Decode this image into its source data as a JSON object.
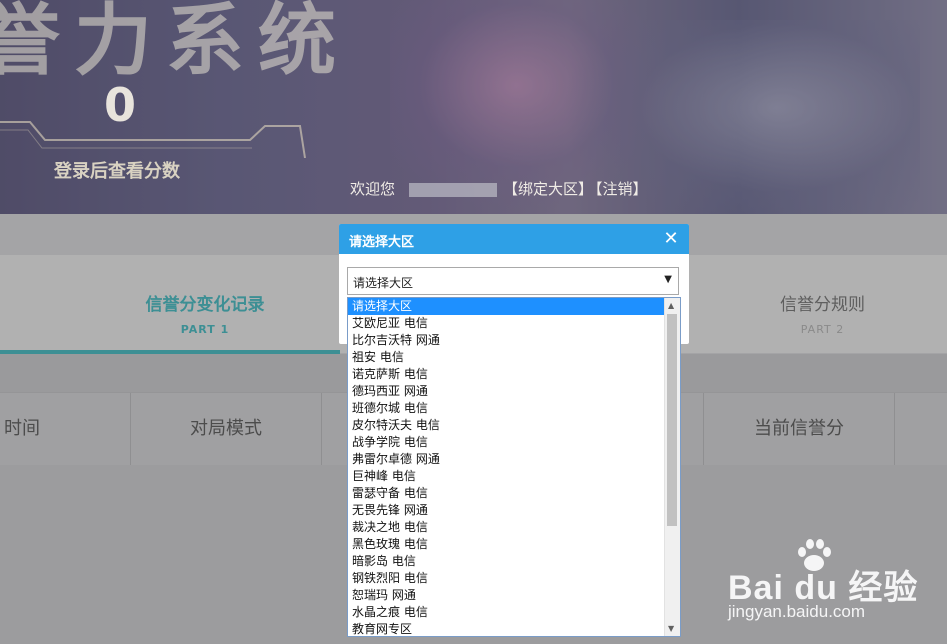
{
  "banner": {
    "title": "誉力系统",
    "score": "0",
    "login_tip": "登录后查看分数",
    "welcome_label": "欢迎您",
    "bind_link": "【绑定大区】",
    "logout_link": "【注销】"
  },
  "tabs": [
    {
      "label": "信誉分变化记录",
      "part": "PART 1",
      "active": true
    },
    {
      "label": "信誉分规则",
      "part": "PART 2",
      "active": false
    }
  ],
  "table": {
    "headers": [
      "时间",
      "对局模式",
      "当前信誉分"
    ]
  },
  "modal": {
    "title": "请选择大区",
    "close_icon": "close-icon",
    "select_value": "请选择大区",
    "options": [
      "请选择大区",
      "艾欧尼亚 电信",
      "比尔吉沃特 网通",
      "祖安 电信",
      "诺克萨斯 电信",
      "德玛西亚 网通",
      "班德尔城 电信",
      "皮尔特沃夫 电信",
      "战争学院 电信",
      "弗雷尔卓德 网通",
      "巨神峰 电信",
      "雷瑟守备 电信",
      "无畏先锋 网通",
      "裁决之地 电信",
      "黑色玫瑰 电信",
      "暗影岛 电信",
      "钢铁烈阳 电信",
      "恕瑞玛 网通",
      "水晶之痕 电信",
      "教育网专区"
    ],
    "selected_index": 0
  },
  "watermark": {
    "logo": "Bai  du 经验",
    "url": "jingyan.baidu.com"
  },
  "colors": {
    "accent": "#2ea0e6",
    "tab_active": "#3d8f94",
    "option_selected": "#1e90ff"
  }
}
